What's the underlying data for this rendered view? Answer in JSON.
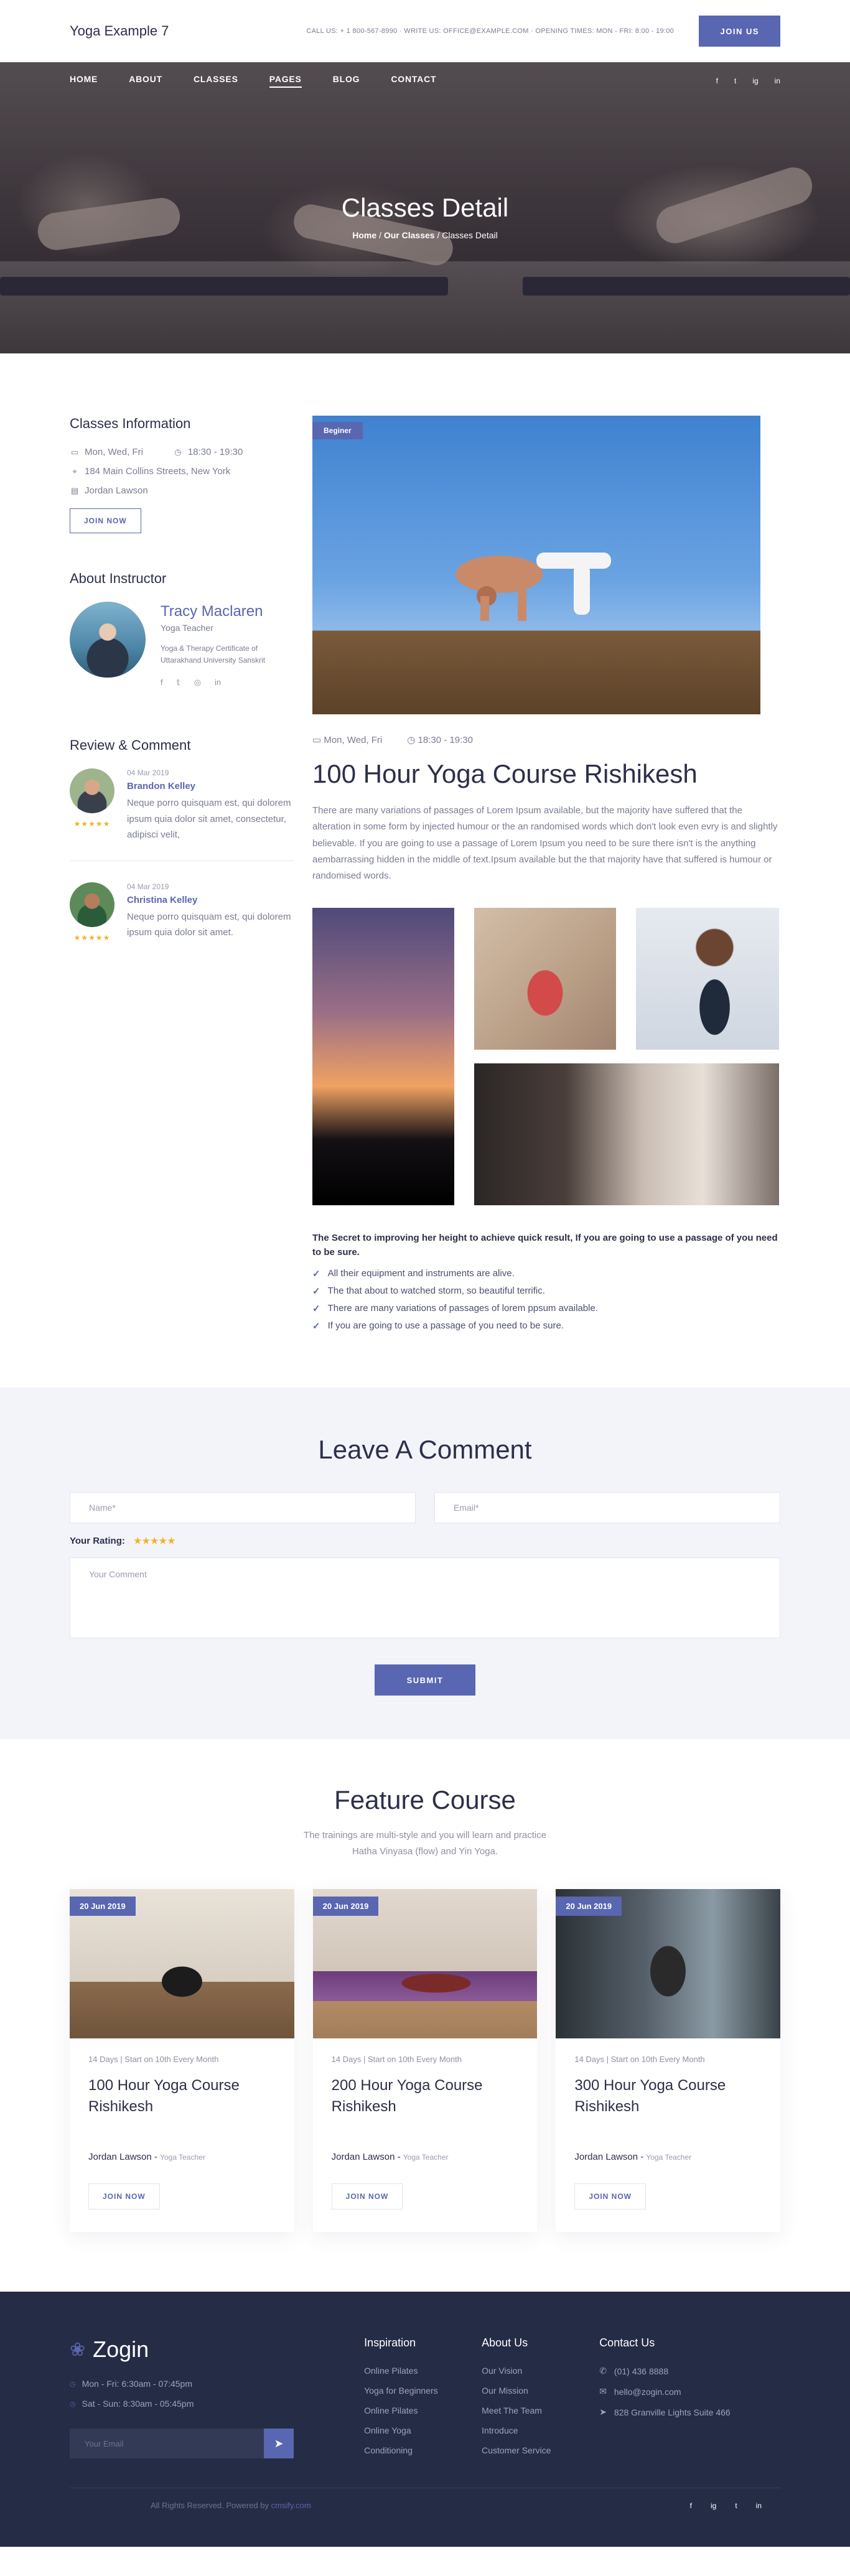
{
  "header": {
    "brand": "Yoga Example 7",
    "contact_line": "CALL US: + 1 800-567-8990 · WRITE US: OFFICE@EXAMPLE.COM · OPENING TIMES: MON - FRI: 8:00 - 19:00",
    "join_label": "JOIN US"
  },
  "nav": {
    "items": [
      "HOME",
      "ABOUT",
      "CLASSES",
      "PAGES",
      "BLOG",
      "CONTACT"
    ],
    "active_index": 3,
    "social_icons": [
      "f",
      "t",
      "ig",
      "in"
    ]
  },
  "hero": {
    "title": "Classes Detail",
    "breadcrumb": [
      "Home",
      "Our Classes",
      "Classes Detail"
    ]
  },
  "sidebar": {
    "info_title": "Classes Information",
    "days": "Mon, Wed, Fri",
    "time": "18:30 - 19:30",
    "address": "184 Main Collins Streets, New York",
    "teacher": "Jordan Lawson",
    "join_now": "JOIN NOW",
    "instructor_title": "About Instructor",
    "instructor": {
      "name": "Tracy Maclaren",
      "role": "Yoga Teacher",
      "cert": "Yoga & Therapy Certificate of Uttarakhand University Sanskrit"
    },
    "review_title": "Review & Comment",
    "reviews": [
      {
        "date": "04 Mar 2019",
        "name": "Brandon Kelley",
        "stars": "★★★★★",
        "text": "Neque porro quisquam est, qui dolorem ipsum quia dolor sit amet, consectetur, adipisci velit,"
      },
      {
        "date": "04 Mar 2019",
        "name": "Christina Kelley",
        "stars": "★★★★★",
        "text": "Neque porro quisquam est, qui dolorem ipsum quia dolor sit amet."
      }
    ]
  },
  "main": {
    "badge": "Beginer",
    "days": "Mon, Wed, Fri",
    "time": "18:30 - 19:30",
    "title": "100 Hour Yoga Course Rishikesh",
    "description": "There are many variations of passages of Lorem Ipsum available, but the majority have suffered that the alteration in some form by injected humour or the an randomised words which don't look even evry is and slightly believable. If you are going to use a passage of Lorem Ipsum you need to be sure there isn't is the anything aembarrassing hidden in the middle of text.Ipsum available but the that majority have that suffered is humour or randomised words.",
    "list_heading": "The Secret to improving her height to achieve quick result, If you are going to use a passage of you need to be sure.",
    "checklist": [
      "All their equipment and instruments are alive.",
      "The that about to watched storm, so beautiful terrific.",
      "There are many variations of passages of lorem ppsum available.",
      "If you are going to use a passage of you need to be sure."
    ]
  },
  "comment": {
    "title": "Leave A Comment",
    "name_placeholder": "Name*",
    "email_placeholder": "Email*",
    "rating_label": "Your Rating:",
    "rating_stars": "★★★★★",
    "comment_placeholder": "Your Comment",
    "submit": "SUBMIT"
  },
  "feature": {
    "title": "Feature Course",
    "subtitle_1": "The trainings are multi-style and you will learn and practice",
    "subtitle_2": "Hatha Vinyasa (flow) and Yin Yoga.",
    "courses": [
      {
        "date": "20 Jun 2019",
        "meta": "14 Days | Start on 10th Every Month",
        "title": "100 Hour Yoga Course Rishikesh",
        "instructor": "Jordan Lawson",
        "role": "Yoga Teacher",
        "cta": "JOIN NOW"
      },
      {
        "date": "20 Jun 2019",
        "meta": "14 Days | Start on 10th Every Month",
        "title": "200 Hour Yoga Course Rishikesh",
        "instructor": "Jordan Lawson",
        "role": "Yoga Teacher",
        "cta": "JOIN NOW"
      },
      {
        "date": "20 Jun 2019",
        "meta": "14 Days | Start on 10th Every Month",
        "title": "300 Hour Yoga Course Rishikesh",
        "instructor": "Jordan Lawson",
        "role": "Yoga Teacher",
        "cta": "JOIN NOW"
      }
    ]
  },
  "footer": {
    "brand": "Zogin",
    "hours_1": "Mon - Fri: 6:30am - 07:45pm",
    "hours_2": "Sat - Sun: 8:30am - 05:45pm",
    "email_placeholder": "Your Email",
    "inspiration_title": "Inspiration",
    "inspiration": [
      "Online Pilates",
      "Yoga for Beginners",
      "Online Pilates",
      "Online Yoga",
      "Conditioning"
    ],
    "about_title": "About Us",
    "about": [
      "Our Vision",
      "Our Mission",
      "Meet The Team",
      "Introduce",
      "Customer Service"
    ],
    "contact_title": "Contact Us",
    "phone": "(01) 436 8888",
    "email": "hello@zogin.com",
    "address": "828 Granville Lights Suite 466",
    "copyright": "All Rights Reserved. Powered by",
    "powered_by": "cmsify.com",
    "social_icons": [
      "f",
      "ig",
      "t",
      "in"
    ]
  }
}
